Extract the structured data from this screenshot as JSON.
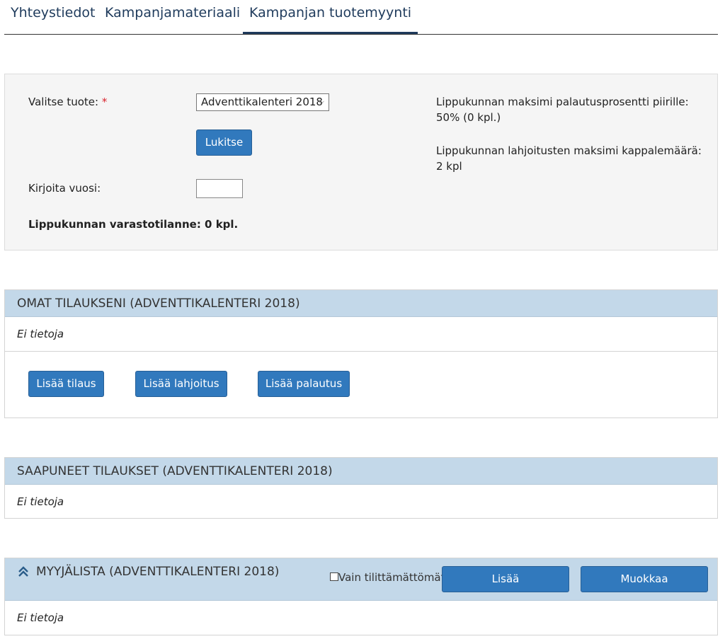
{
  "tabs": [
    {
      "label": "Yhteystiedot",
      "active": false
    },
    {
      "label": "Kampanjamateriaali",
      "active": false
    },
    {
      "label": "Kampanjan tuotemyynti",
      "active": true
    }
  ],
  "product_panel": {
    "select_label": "Valitse tuote:",
    "required_mark": "*",
    "selected_product": "Adventtikalenteri 2018",
    "lock_button": "Lukitse",
    "year_label": "Kirjoita vuosi:",
    "year_value": "",
    "stock_status": "Lippukunnan varastotilanne: 0 kpl.",
    "max_return_label": "Lippukunnan maksimi palautusprosentti piirille:",
    "max_return_value": "50% (0 kpl.)",
    "max_donation_label": "Lippukunnan lahjoitusten maksimi kappalemäärä:",
    "max_donation_value": "2 kpl"
  },
  "own_orders": {
    "title": "OMAT TILAUKSENI (ADVENTTIKALENTERI 2018)",
    "empty_text": "Ei tietoja",
    "add_order": "Lisää tilaus",
    "add_donation": "Lisää lahjoitus",
    "add_return": "Lisää palautus"
  },
  "received_orders": {
    "title": "SAAPUNEET TILAUKSET (ADVENTTIKALENTERI 2018)",
    "empty_text": "Ei tietoja"
  },
  "seller_list": {
    "title": "MYYJÄLISTA (ADVENTTIKALENTERI 2018)",
    "checkbox_label": "Vain tilittämättömät",
    "checkbox_checked": false,
    "add_button": "Lisää",
    "edit_button": "Muokkaa",
    "empty_text": "Ei tietoja"
  },
  "colors": {
    "accent": "#3179bd",
    "section_header": "#c3d8e9",
    "tab_text": "#1f3b5c",
    "required": "#d9232d"
  }
}
